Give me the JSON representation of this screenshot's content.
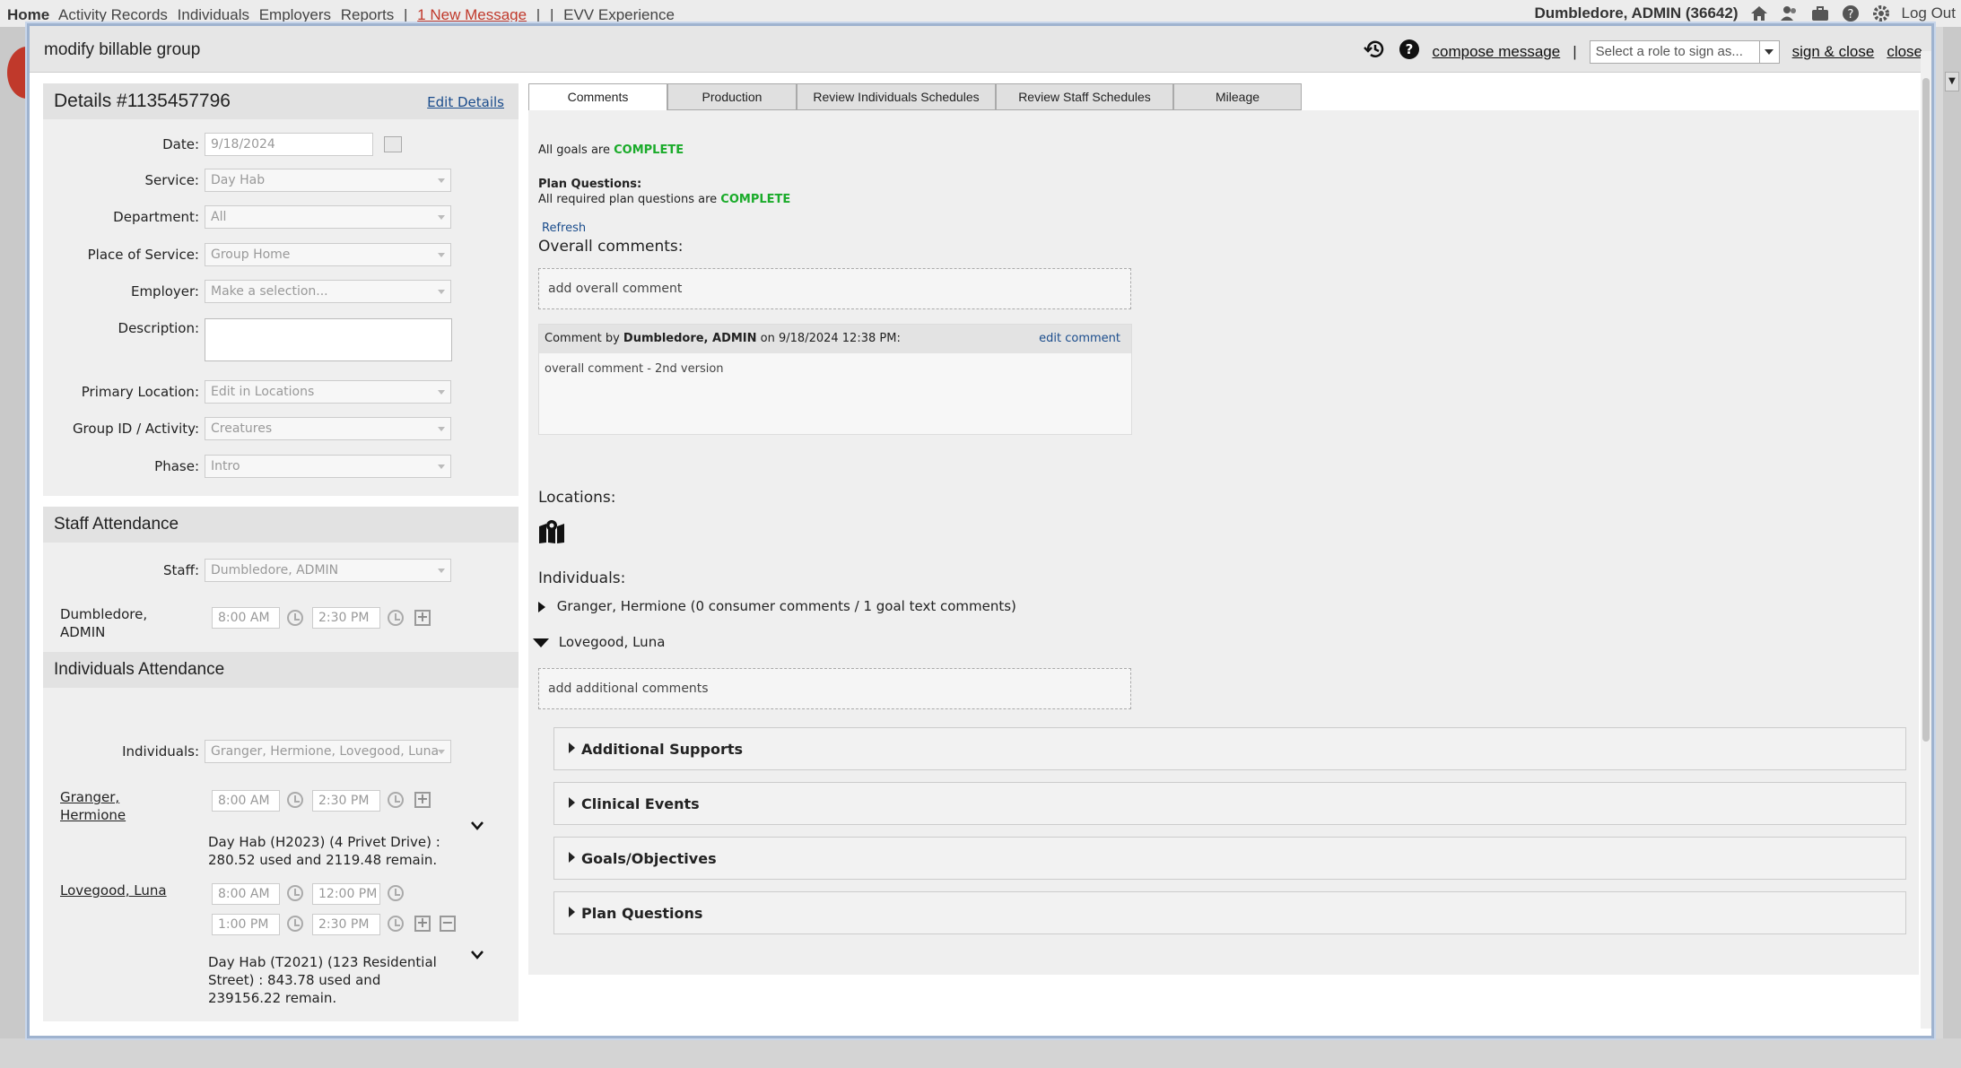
{
  "topnav": {
    "items": [
      "Home",
      "Activity Records",
      "Individuals",
      "Employers",
      "Reports",
      "|",
      "1 New Message",
      "|",
      "|",
      "EVV Experience"
    ],
    "user": "Dumbledore, ADMIN (36642)",
    "logout": "Log Out"
  },
  "modal": {
    "title": "modify billable group",
    "compose": "compose message",
    "sep": "|",
    "role_placeholder": "Select a role to sign as...",
    "sign_close": "sign & close",
    "close": "close"
  },
  "details": {
    "title": "Details #1135457796",
    "edit": "Edit Details",
    "fields": {
      "date": {
        "label": "Date:",
        "value": "9/18/2024"
      },
      "service": {
        "label": "Service:",
        "value": "Day Hab"
      },
      "department": {
        "label": "Department:",
        "value": "All"
      },
      "place": {
        "label": "Place of Service:",
        "value": "Group Home"
      },
      "employer": {
        "label": "Employer:",
        "value": "Make a selection..."
      },
      "description": {
        "label": "Description:",
        "value": ""
      },
      "primary_location": {
        "label": "Primary Location:",
        "value": "Edit in Locations"
      },
      "group": {
        "label": "Group ID / Activity:",
        "value": "Creatures"
      },
      "phase": {
        "label": "Phase:",
        "value": "Intro"
      }
    }
  },
  "staff": {
    "title": "Staff Attendance",
    "label": "Staff:",
    "value": "Dumbledore, ADMIN",
    "person": "Dumbledore, ADMIN",
    "start": "8:00 AM",
    "end": "2:30 PM"
  },
  "individuals_att": {
    "title": "Individuals Attendance",
    "label": "Individuals:",
    "value": "Granger, Hermione, Lovegood, Luna",
    "people": [
      {
        "name": "Granger, Hermione",
        "start": "8:00 AM",
        "end": "2:30 PM",
        "budget": "Day Hab (H2023) (4 Privet Drive) : 280.52 used and 2119.48 remain."
      },
      {
        "name": "Lovegood, Luna",
        "start": "8:00 AM",
        "end": "12:00 PM",
        "start2": "1:00 PM",
        "end2": "2:30 PM",
        "budget": "Day Hab (T2021) (123 Residential Street) : 843.78 used and 239156.22 remain."
      }
    ]
  },
  "tabs": [
    "Comments",
    "Production",
    "Review Individuals Schedules",
    "Review Staff Schedules",
    "Mileage"
  ],
  "comments_tab": {
    "goals_prefix": "All goals are",
    "goals_status": "COMPLETE",
    "plan_title": "Plan Questions:",
    "plan_prefix": "All required plan questions are",
    "plan_status": "COMPLETE",
    "refresh": "Refresh",
    "overall_title": "Overall comments:",
    "add_overall": "add overall comment",
    "comment_by_prefix": "Comment by",
    "comment_author": "Dumbledore, ADMIN",
    "comment_on": "on 9/18/2024 12:38 PM:",
    "edit_comment": "edit comment",
    "comment_text": "overall comment - 2nd version",
    "locations_title": "Locations:",
    "individuals_title": "Individuals:",
    "individual1": "Granger, Hermione (0 consumer comments / 1  goal text comments)",
    "individual2": "Lovegood, Luna",
    "add_additional": "add additional comments",
    "sections": [
      "Additional Supports",
      "Clinical Events",
      "Goals/Objectives",
      "Plan Questions"
    ]
  }
}
